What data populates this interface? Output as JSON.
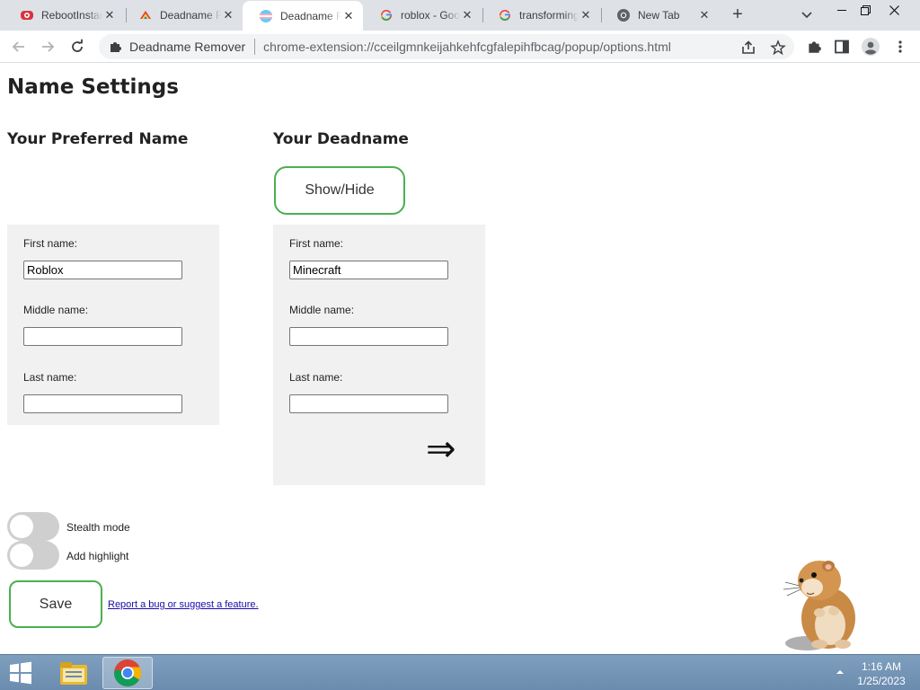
{
  "browser": {
    "tabs": [
      {
        "title": "RebootInstan",
        "icon": "red-cog-favicon",
        "active": false
      },
      {
        "title": "Deadname R",
        "icon": "rainbow-favicon",
        "active": false
      },
      {
        "title": "Deadname R",
        "icon": "trans-flag-favicon",
        "active": true
      },
      {
        "title": "roblox - Goo",
        "icon": "google-g-icon",
        "active": false
      },
      {
        "title": "transforming",
        "icon": "google-g-icon",
        "active": false
      },
      {
        "title": "New Tab",
        "icon": "chrome-icon",
        "active": false
      }
    ],
    "new_tab_label": "+",
    "omnibox": {
      "extension_name": "Deadname Remover",
      "url": "chrome-extension://cceilgmnkeijahkehfcgfalepihfbcag/popup/options.html"
    }
  },
  "page": {
    "title": "Name Settings",
    "preferred": {
      "heading": "Your Preferred Name",
      "first_label": "First name:",
      "first_value": "Roblox",
      "middle_label": "Middle name:",
      "middle_value": "",
      "last_label": "Last name:",
      "last_value": ""
    },
    "deadname": {
      "heading": "Your Deadname",
      "show_hide_label": "Show/Hide",
      "first_label": "First name:",
      "first_value": "Minecraft",
      "middle_label": "Middle name:",
      "middle_value": "",
      "last_label": "Last name:",
      "last_value": "",
      "arrow_symbol": "⇒"
    },
    "toggles": {
      "stealth_label": "Stealth mode",
      "stealth_on": false,
      "highlight_label": "Add highlight",
      "highlight_on": false
    },
    "save_label": "Save",
    "report_link": "Report a bug or suggest a feature."
  },
  "taskbar": {
    "time": "1:16 AM",
    "date": "1/25/2023"
  },
  "colors": {
    "accent_green": "#4caf50",
    "panel_gray": "#f1f1f1",
    "tabstrip": "#dee1e6",
    "taskbar": "#6b8cae"
  }
}
